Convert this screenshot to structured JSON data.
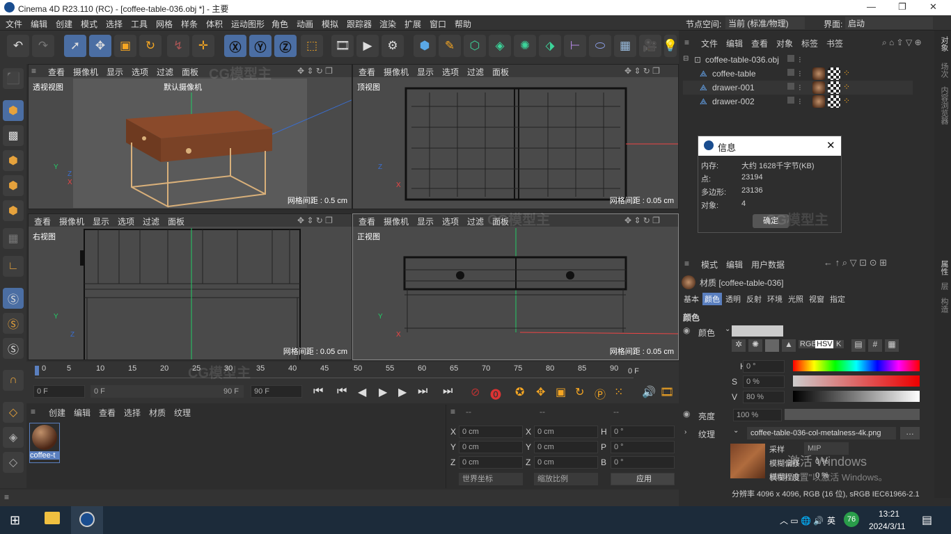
{
  "title_bar": {
    "title": "Cinema 4D R23.110 (RC) - [coffee-table-036.obj *] - 主要",
    "minimize": "—",
    "maximize": "❐",
    "close": "✕"
  },
  "menu": {
    "items": [
      "文件",
      "编辑",
      "创建",
      "模式",
      "选择",
      "工具",
      "网格",
      "样条",
      "体积",
      "运动图形",
      "角色",
      "动画",
      "模拟",
      "跟踪器",
      "渲染",
      "扩展",
      "窗口",
      "帮助"
    ],
    "node_space_label": "节点空间:",
    "node_space_value": "当前 (标准/物理)",
    "interface_label": "界面:",
    "interface_value": "启动"
  },
  "viewport_menu": [
    "查看",
    "摄像机",
    "显示",
    "选项",
    "过滤",
    "面板"
  ],
  "viewports": {
    "perspective": {
      "name": "透视视图",
      "camera": "默认摄像机",
      "grid": "网格间距 : 0.5 cm"
    },
    "top": {
      "name": "顶视图",
      "grid": "网格间距 : 0.05 cm"
    },
    "right": {
      "name": "右视图",
      "grid": "网格间距 : 0.05 cm"
    },
    "front": {
      "name": "正视图",
      "grid": "网格间距 : 0.05 cm"
    }
  },
  "timeline": {
    "ticks": [
      "0",
      "5",
      "10",
      "15",
      "20",
      "25",
      "30",
      "35",
      "40",
      "45",
      "50",
      "55",
      "60",
      "65",
      "70",
      "75",
      "80",
      "85",
      "90"
    ],
    "end_label": "0 F",
    "start_field": "0 F",
    "range_start": "0 F",
    "range_end": "90 F",
    "end_field": "90 F"
  },
  "material_manager": {
    "menu": [
      "创建",
      "编辑",
      "查看",
      "选择",
      "材质",
      "纹理"
    ],
    "material_name": "coffee-t"
  },
  "coords": {
    "header": [
      "--",
      "--",
      "--"
    ],
    "rows": [
      {
        "a": "X",
        "av": "0 cm",
        "b": "X",
        "bv": "0 cm",
        "c": "H",
        "cv": "0 °"
      },
      {
        "a": "Y",
        "av": "0 cm",
        "b": "Y",
        "bv": "0 cm",
        "c": "P",
        "cv": "0 °"
      },
      {
        "a": "Z",
        "av": "0 cm",
        "b": "Z",
        "bv": "0 cm",
        "c": "B",
        "cv": "0 °"
      }
    ],
    "world": "世界坐标",
    "scale": "缩放比例",
    "apply": "应用"
  },
  "object_manager": {
    "menu": [
      "文件",
      "编辑",
      "查看",
      "对象",
      "标签",
      "书签"
    ],
    "objects": [
      {
        "name": "coffee-table-036.obj"
      },
      {
        "name": "coffee-table"
      },
      {
        "name": "drawer-001"
      },
      {
        "name": "drawer-002"
      }
    ],
    "side_tabs": [
      "对象",
      "场次",
      "内容浏览器"
    ]
  },
  "info_dialog": {
    "title": "信息",
    "rows": [
      {
        "k": "内存:",
        "v": "大约 1628千字节(KB)"
      },
      {
        "k": "点:",
        "v": "23194"
      },
      {
        "k": "多边形:",
        "v": "23136"
      },
      {
        "k": "对象:",
        "v": "4"
      }
    ],
    "ok": "确定"
  },
  "attributes": {
    "menu": [
      "模式",
      "编辑",
      "用户数据"
    ],
    "material": "材质 [coffee-table-036]",
    "tabs": [
      "基本",
      "颜色",
      "透明",
      "反射",
      "环境",
      "光照",
      "视窗",
      "指定"
    ],
    "active_tab": "颜色",
    "section": "颜色",
    "color_label": "颜色",
    "color_modes": [
      "RGB",
      "HSV",
      "K"
    ],
    "h": {
      "label": "H",
      "value": "0 °"
    },
    "s": {
      "label": "S",
      "value": "0 %"
    },
    "v": {
      "label": "V",
      "value": "80 %"
    },
    "brightness": {
      "label": "亮度",
      "value": "100 %"
    },
    "texture_label": "纹理",
    "texture_file": "coffee-table-036-col-metalness-4k.png",
    "sampling_label": "采样",
    "sampling_value": "MIP",
    "blur_offset_label": "模糊偏移",
    "blur_offset_value": "0 %",
    "blur_scale_label": "模糊程度",
    "blur_scale_value": "0 %",
    "resolution": "分辨率 4096 x 4096, RGB (16 位), sRGB IEC61966-2.1",
    "side_tabs": [
      "属性",
      "层",
      "构造"
    ],
    "watermark1": "激活 Windows",
    "watermark2": "转到\"设置\"以激活 Windows。"
  },
  "taskbar": {
    "lang": "英",
    "badge": "76",
    "time": "13:21",
    "date": "2024/3/11"
  },
  "watermark": "CG模型主"
}
